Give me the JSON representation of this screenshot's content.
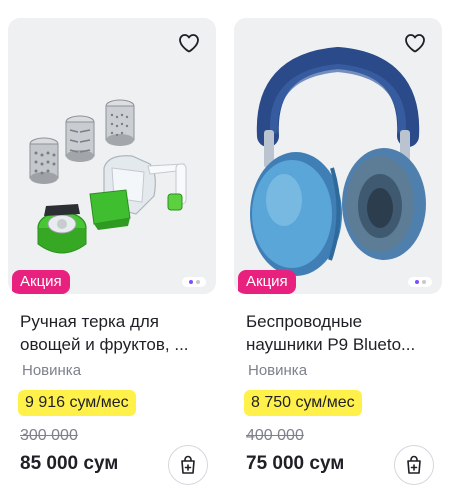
{
  "products": [
    {
      "title_line1": "Ручная терка для",
      "title_line2": "овощей и фруктов, ...",
      "badge": "Акция",
      "tag": "Новинка",
      "installment": "9 916 сум/мес",
      "old_price": "300 000",
      "price": "85 000 сум",
      "image_icon": "vegetable-grater-image",
      "carousel_pages": 2,
      "carousel_active": 1
    },
    {
      "title_line1": "Беспроводные",
      "title_line2": "наушники P9 Blueto...",
      "badge": "Акция",
      "tag": "Новинка",
      "installment": "8 750 сум/мес",
      "old_price": "400 000",
      "price": "75 000 сум",
      "image_icon": "headphones-image",
      "carousel_pages": 2,
      "carousel_active": 1
    }
  ],
  "icons": {
    "favorite": "heart-icon",
    "cart": "add-to-cart-icon"
  },
  "colors": {
    "badge": "#e8207e",
    "installment_highlight": "#fff14a",
    "carousel_active": "#7f4dff",
    "photo_background": "#eff0f2"
  }
}
